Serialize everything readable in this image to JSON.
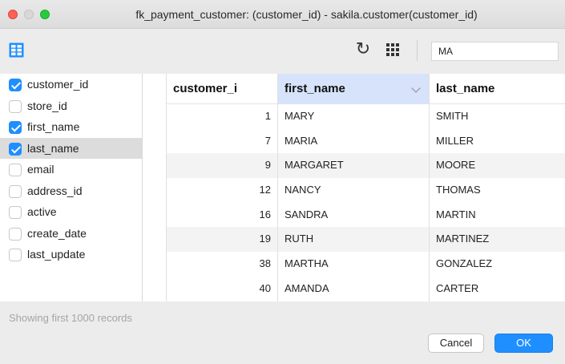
{
  "window": {
    "title": "fk_payment_customer: (customer_id) - sakila.customer(customer_id)"
  },
  "toolbar": {
    "view_icon": "table-view-icon",
    "refresh_icon": "refresh-icon",
    "refresh_glyph": "↻",
    "columns_icon": "columns-grid-icon",
    "search": {
      "value": "MA",
      "placeholder": ""
    }
  },
  "columns_panel": {
    "items": [
      {
        "label": "customer_id",
        "checked": true,
        "selected": false
      },
      {
        "label": "store_id",
        "checked": false,
        "selected": false
      },
      {
        "label": "first_name",
        "checked": true,
        "selected": false
      },
      {
        "label": "last_name",
        "checked": true,
        "selected": true
      },
      {
        "label": "email",
        "checked": false,
        "selected": false
      },
      {
        "label": "address_id",
        "checked": false,
        "selected": false
      },
      {
        "label": "active",
        "checked": false,
        "selected": false
      },
      {
        "label": "create_date",
        "checked": false,
        "selected": false
      },
      {
        "label": "last_update",
        "checked": false,
        "selected": false
      }
    ]
  },
  "table": {
    "headers": [
      "customer_i",
      "first_name",
      "last_name"
    ],
    "sorted_column": "first_name",
    "rows": [
      {
        "customer_id": "1",
        "first_name": "MARY",
        "last_name": "SMITH"
      },
      {
        "customer_id": "7",
        "first_name": "MARIA",
        "last_name": "MILLER"
      },
      {
        "customer_id": "9",
        "first_name": "MARGARET",
        "last_name": "MOORE"
      },
      {
        "customer_id": "12",
        "first_name": "NANCY",
        "last_name": "THOMAS"
      },
      {
        "customer_id": "16",
        "first_name": "SANDRA",
        "last_name": "MARTIN"
      },
      {
        "customer_id": "19",
        "first_name": "RUTH",
        "last_name": "MARTINEZ"
      },
      {
        "customer_id": "38",
        "first_name": "MARTHA",
        "last_name": "GONZALEZ"
      },
      {
        "customer_id": "40",
        "first_name": "AMANDA",
        "last_name": "CARTER"
      }
    ]
  },
  "footer": {
    "status": "Showing first 1000 records",
    "cancel_label": "Cancel",
    "ok_label": "OK"
  },
  "colors": {
    "accent": "#1f8fff",
    "header_highlight": "#d6e3fa",
    "close": "#fe5f57",
    "maximize": "#29c940"
  }
}
